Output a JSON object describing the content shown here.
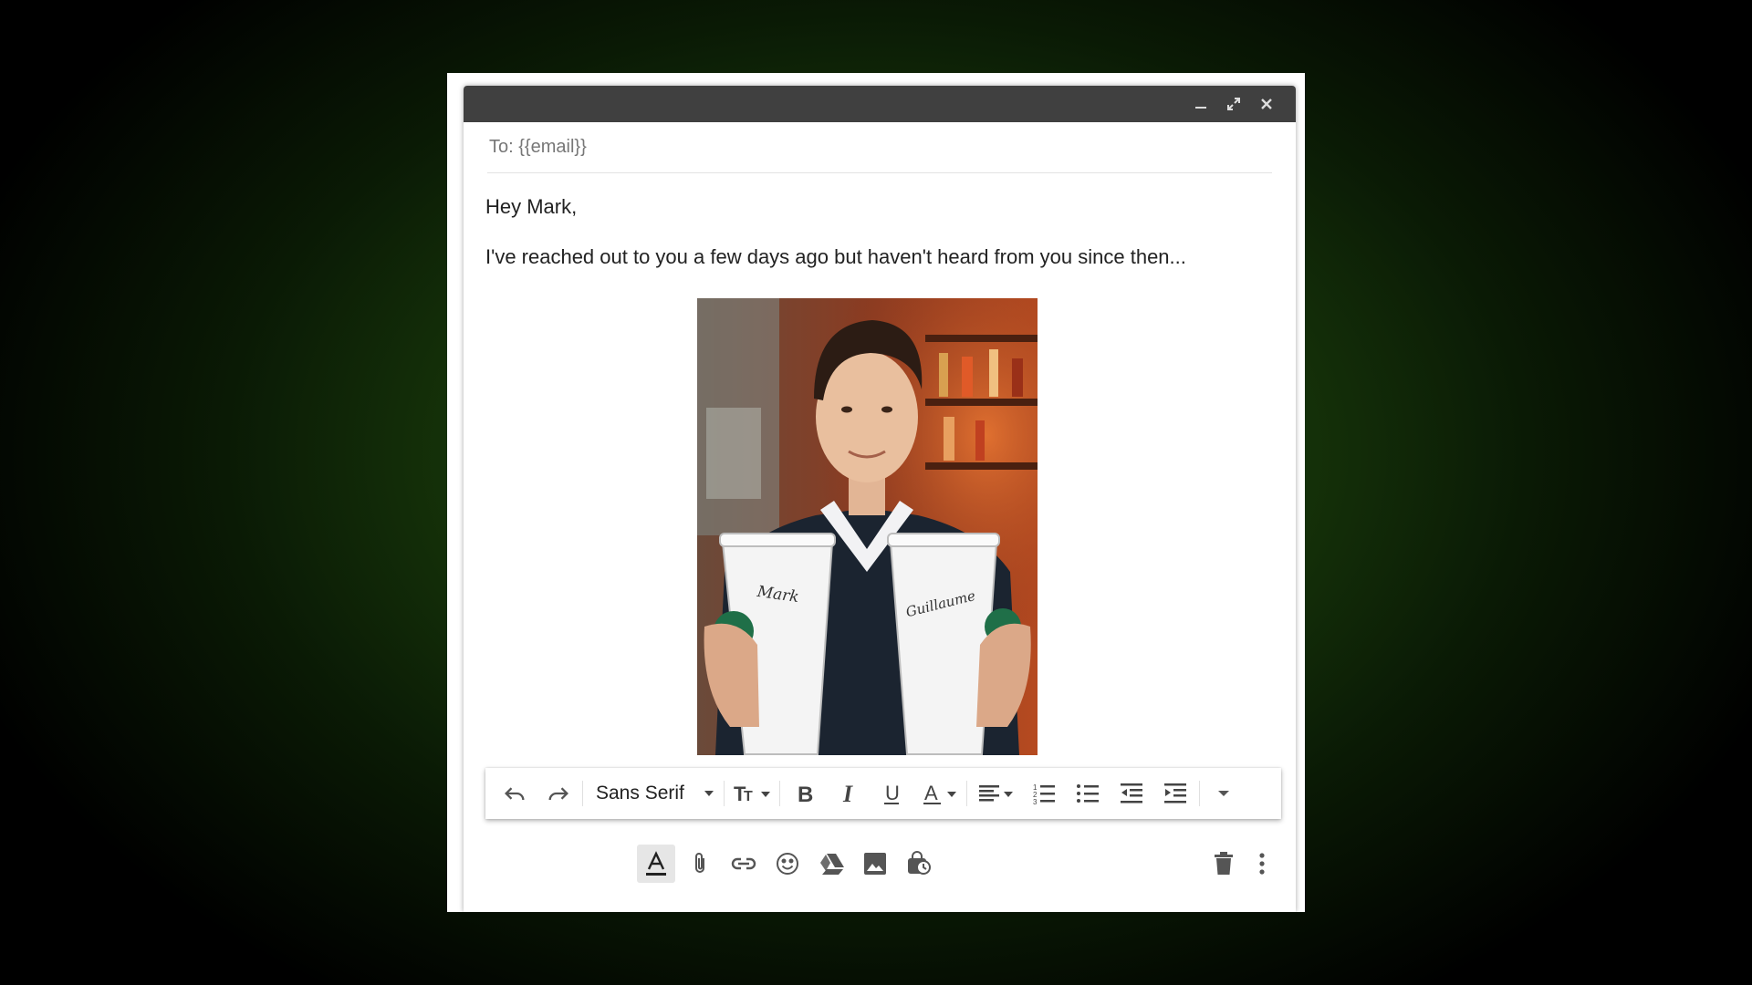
{
  "window": {
    "controls": [
      "minimize-icon",
      "expand-icon",
      "close-icon"
    ]
  },
  "to_field": {
    "value": "To: {{email}}"
  },
  "message": {
    "greeting": "Hey Mark,",
    "paragraph": "I've reached out to you a few days ago but haven't heard from you since then..."
  },
  "photo": {
    "cup_left_text": "Mark",
    "cup_right_text": "Guillaume"
  },
  "toolbar": {
    "font": "Sans Serif",
    "items": [
      "undo-icon",
      "redo-icon",
      "font-select",
      "text-size-icon",
      "bold-icon",
      "italic-icon",
      "underline-icon",
      "text-color-icon",
      "align-icon",
      "numbered-list-icon",
      "bulleted-list-icon",
      "indent-less-icon",
      "indent-more-icon",
      "more-formatting-icon"
    ]
  },
  "bottom_actions": [
    "formatting-options-icon",
    "attach-icon",
    "link-icon",
    "emoji-icon",
    "drive-icon",
    "photo-icon",
    "confidential-icon",
    "delete-icon",
    "more-options-icon"
  ],
  "colors": {
    "titlebar": "#404040",
    "icon": "#444444",
    "background_green": "#2a5a14"
  }
}
